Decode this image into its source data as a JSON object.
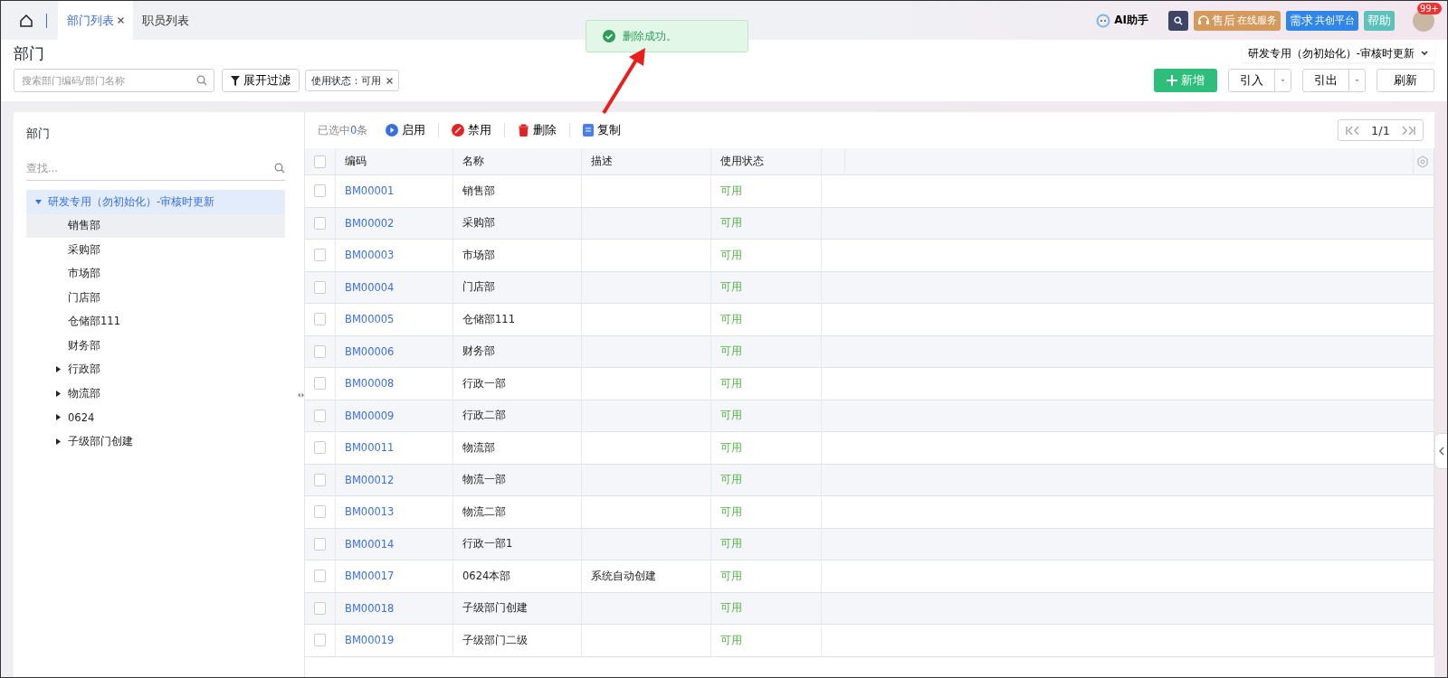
{
  "tabs": [
    {
      "label": "部门列表",
      "selected": true
    },
    {
      "label": "职员列表",
      "selected": false
    }
  ],
  "header_actions": {
    "ai": "AI助手",
    "service": {
      "main": "售后",
      "sub": "在线服务"
    },
    "platform": {
      "main": "需求",
      "sub": "共创平台"
    },
    "help": "帮助",
    "badge": "99+"
  },
  "toast": {
    "message": "删除成功。"
  },
  "page_title": "部门",
  "org_selector": "研发专用（勿初始化）-审核时更新",
  "search": {
    "placeholder": "搜索部门编码/部门名称"
  },
  "filter_button": "展开过滤",
  "filter_tag": "使用状态：可用",
  "actions": {
    "add": "新增",
    "import": "引入",
    "export": "引出",
    "refresh": "刷新"
  },
  "sidebar": {
    "title": "部门",
    "search_placeholder": "查找...",
    "tree": [
      {
        "label": "研发专用（勿初始化）-审核时更新",
        "selected": true,
        "expanded": true,
        "children": [
          {
            "label": "销售部",
            "selected": false,
            "highlighted": true
          },
          {
            "label": "采购部",
            "selected": false,
            "highlighted": false
          },
          {
            "label": "市场部",
            "selected": false,
            "highlighted": false
          },
          {
            "label": "门店部",
            "selected": false,
            "highlighted": false
          },
          {
            "label": "仓储部111",
            "selected": false,
            "highlighted": false
          },
          {
            "label": "财务部",
            "selected": false,
            "highlighted": false
          },
          {
            "label": "行政部",
            "selected": false,
            "highlighted": false,
            "expanded": false
          },
          {
            "label": "物流部",
            "selected": false,
            "highlighted": false,
            "expanded": false
          },
          {
            "label": "0624",
            "selected": false,
            "highlighted": false,
            "expanded": false
          },
          {
            "label": "子级部门创建",
            "selected": false,
            "highlighted": false,
            "expanded": false
          }
        ]
      }
    ]
  },
  "toolbar": {
    "selected_prefix": "已选中",
    "selected_count": "0",
    "selected_suffix": "条",
    "buttons": [
      {
        "kind": "enable",
        "label": "启用"
      },
      {
        "kind": "disable",
        "label": "禁用"
      },
      {
        "kind": "delete",
        "label": "删除"
      },
      {
        "kind": "copy",
        "label": "复制"
      }
    ],
    "pager": "1/1"
  },
  "table": {
    "all_checked": false,
    "columns": [
      "编码",
      "名称",
      "描述",
      "使用状态"
    ],
    "rows": [
      {
        "checked": false,
        "code": "BM00001",
        "name": "销售部",
        "description": "",
        "status": "可用"
      },
      {
        "checked": false,
        "code": "BM00002",
        "name": "采购部",
        "description": "",
        "status": "可用"
      },
      {
        "checked": false,
        "code": "BM00003",
        "name": "市场部",
        "description": "",
        "status": "可用"
      },
      {
        "checked": false,
        "code": "BM00004",
        "name": "门店部",
        "description": "",
        "status": "可用"
      },
      {
        "checked": false,
        "code": "BM00005",
        "name": "仓储部111",
        "description": "",
        "status": "可用"
      },
      {
        "checked": false,
        "code": "BM00006",
        "name": "财务部",
        "description": "",
        "status": "可用"
      },
      {
        "checked": false,
        "code": "BM00008",
        "name": "行政一部",
        "description": "",
        "status": "可用"
      },
      {
        "checked": false,
        "code": "BM00009",
        "name": "行政二部",
        "description": "",
        "status": "可用"
      },
      {
        "checked": false,
        "code": "BM00011",
        "name": "物流部",
        "description": "",
        "status": "可用"
      },
      {
        "checked": false,
        "code": "BM00012",
        "name": "物流一部",
        "description": "",
        "status": "可用"
      },
      {
        "checked": false,
        "code": "BM00013",
        "name": "物流二部",
        "description": "",
        "status": "可用"
      },
      {
        "checked": false,
        "code": "BM00014",
        "name": "行政一部1",
        "description": "",
        "status": "可用"
      },
      {
        "checked": false,
        "code": "BM00017",
        "name": "0624本部",
        "description": "系统自动创建",
        "status": "可用"
      },
      {
        "checked": false,
        "code": "BM00018",
        "name": "子级部门创建",
        "description": "",
        "status": "可用"
      },
      {
        "checked": false,
        "code": "BM00019",
        "name": "子级部门二级",
        "description": "",
        "status": "可用"
      }
    ]
  }
}
